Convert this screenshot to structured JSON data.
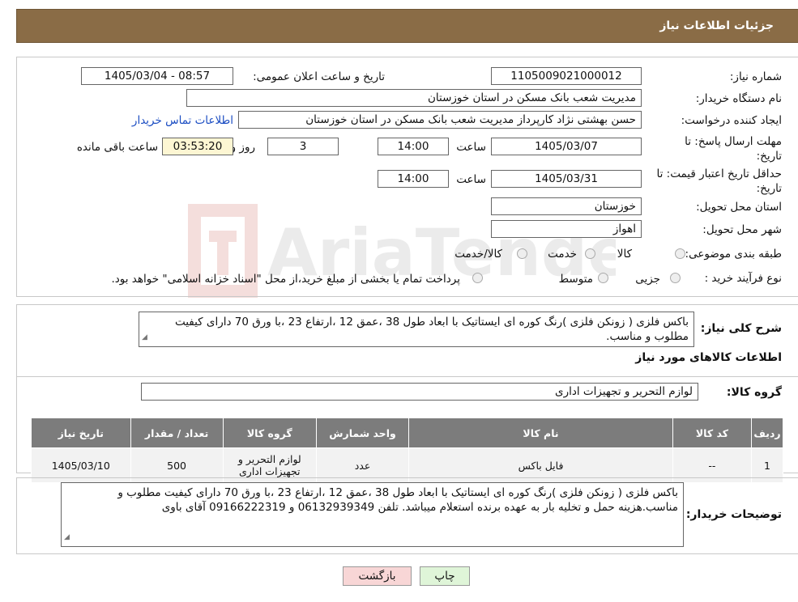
{
  "header": {
    "title": "جزئیات اطلاعات نیاز"
  },
  "form": {
    "need_number_label": "شماره نیاز:",
    "need_number": "1105009021000012",
    "announce_label": "تاریخ و ساعت اعلان عمومی:",
    "announce_value": "1405/03/04 - 08:57",
    "buyer_org_label": "نام دستگاه خریدار:",
    "buyer_org": "مدیریت شعب بانک مسکن در استان خوزستان",
    "creator_label": "ایجاد کننده درخواست:",
    "creator": "حسن بهشتی نژاد کارپرداز مدیریت شعب بانک مسکن در استان خوزستان",
    "contact_link": "اطلاعات تماس خریدار",
    "deadline_label": "مهلت ارسال پاسخ: تا تاریخ:",
    "deadline_date": "1405/03/07",
    "time_label": "ساعت",
    "deadline_time": "14:00",
    "days_value": "3",
    "days_label": "روز و",
    "remaining_time": "03:53:20",
    "remaining_label": "ساعت باقی مانده",
    "price_validity_label": "حداقل تاریخ اعتبار قیمت: تا تاریخ:",
    "price_validity_date": "1405/03/31",
    "price_validity_time": "14:00",
    "province_label": "استان محل تحویل:",
    "province": "خوزستان",
    "city_label": "شهر محل تحویل:",
    "city": "اهواز",
    "category_label": "طبقه بندی موضوعی:",
    "category_options": [
      "کالا",
      "خدمت",
      "کالا/خدمت"
    ],
    "purchase_type_label": "نوع فرآیند خرید :",
    "purchase_options": [
      "جزیی",
      "متوسط"
    ],
    "purchase_note": "پرداخت تمام یا بخشی از مبلغ خرید،از محل \"اسناد خزانه اسلامی\" خواهد بود."
  },
  "description": {
    "label": "شرح کلی نیاز:",
    "text": "باکس فلزی ( زونکن فلزی )رنگ کوره ای ایستاتیک با ابعاد  طول 38  ،عمق 12  ،ارتفاع 23 ،با ورق 70  دارای کیفیت مطلوب و مناسب."
  },
  "goods_section": {
    "title": "اطلاعات کالاهای مورد نیاز",
    "group_label": "گروه کالا:",
    "group_value": "لوازم التحریر و تجهیزات اداری"
  },
  "table": {
    "headers": [
      "ردیف",
      "کد کالا",
      "نام کالا",
      "واحد شمارش",
      "گروه کالا",
      "تعداد / مقدار",
      "تاریخ نیاز"
    ],
    "rows": [
      {
        "row": "1",
        "code": "--",
        "name": "فایل باکس",
        "unit": "عدد",
        "group": "لوازم التحریر و تجهیزات اداری",
        "qty": "500",
        "date": "1405/03/10"
      }
    ]
  },
  "buyer_notes": {
    "label": "توضیحات خریدار:",
    "text": "باکس فلزی ( زونکن فلزی )رنگ کوره ای ایستاتیک با ابعاد  طول 38  ،عمق 12  ،ارتفاع 23 ،با ورق 70  دارای کیفیت مطلوب و مناسب.هزینه حمل و تخلیه بار به عهده برنده استعلام میباشد. تلفن 06132939349 و 09166222319 آقای باوی"
  },
  "buttons": {
    "print": "چاپ",
    "back": "بازگشت"
  },
  "watermark": {
    "text": "AriaTender.neT"
  },
  "colors": {
    "header_bg": "#8a6c46",
    "table_header_bg": "#7c7c7c",
    "link": "#1a4cc2",
    "back_btn_bg": "#f8d6d6",
    "print_btn_bg": "#dff5d8"
  }
}
